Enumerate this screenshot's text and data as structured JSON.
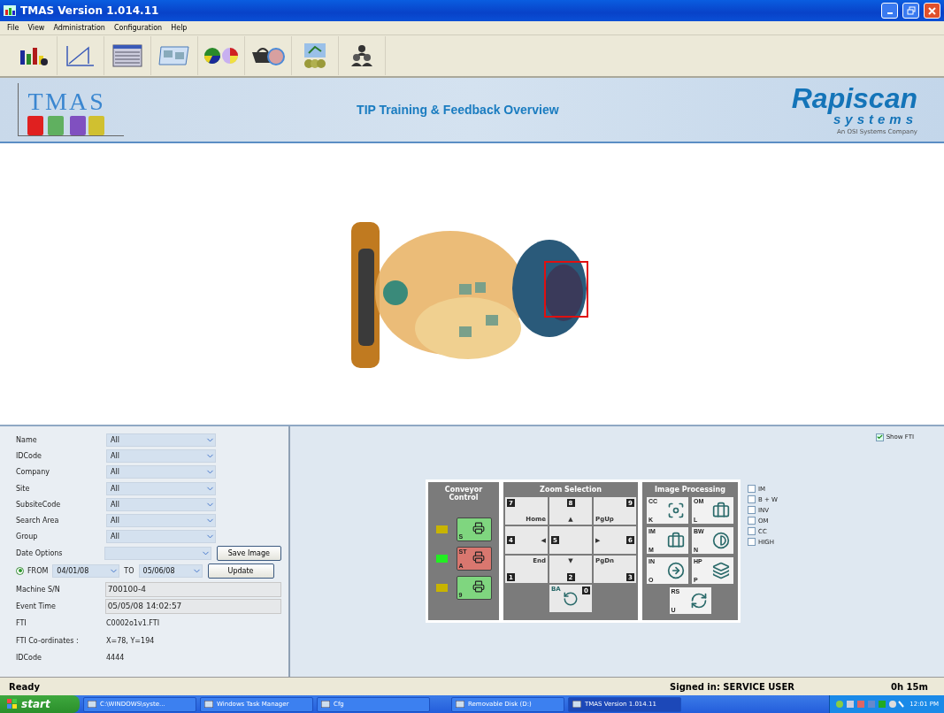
{
  "window": {
    "title": "TMAS Version 1.014.11"
  },
  "menu": [
    "File",
    "View",
    "Administration",
    "Configuration",
    "Help"
  ],
  "header": {
    "logo": "TMAS",
    "title": "TIP Training & Feedback Overview",
    "brand": "Rapiscan",
    "brand_sub": "systems",
    "brand_tagline": "An OSI Systems Company"
  },
  "filters": [
    {
      "label": "Name",
      "value": "All"
    },
    {
      "label": "IDCode",
      "value": "All"
    },
    {
      "label": "Company",
      "value": "All"
    },
    {
      "label": "Site",
      "value": "All"
    },
    {
      "label": "SubsiteCode",
      "value": "All"
    },
    {
      "label": "Search Area",
      "value": "All"
    },
    {
      "label": "Group",
      "value": "All"
    }
  ],
  "date_options": {
    "label": "Date Options"
  },
  "date_range": {
    "selected": true,
    "from_label": "FROM",
    "from": "04/01/08",
    "to_label": "TO",
    "to": "05/06/08"
  },
  "buttons": [
    "Save Image",
    "Update"
  ],
  "details": [
    {
      "label": "Machine S/N",
      "value": "700100-4",
      "kind": "field"
    },
    {
      "label": "Event Time",
      "value": "05/05/08 14:02:57",
      "kind": "field"
    },
    {
      "label": "FTI",
      "value": "C0002o1v1.FTI",
      "kind": "text"
    },
    {
      "label": "FTI Co-ordinates :",
      "value": "X=78, Y=194",
      "kind": "text"
    },
    {
      "label": "IDCode",
      "value": "4444",
      "kind": "text"
    }
  ],
  "show_fti": {
    "label": "Show FTI",
    "checked": true
  },
  "conveyor": {
    "title": "Conveyor Control",
    "lamps": [
      {
        "color": "#c8b400"
      },
      {
        "color": "#22ee22"
      },
      {
        "color": "#c8b400"
      }
    ],
    "buttons": [
      {
        "key": "S",
        "color": "#7fd67f"
      },
      {
        "code": "ST",
        "key": "A",
        "color": "#d9776f"
      },
      {
        "key": "9",
        "color": "#7fd67f"
      }
    ]
  },
  "zoom": {
    "title": "Zoom Selection",
    "keys": [
      {
        "num": "7",
        "label": "Home"
      },
      {
        "num": "8",
        "label": "▲"
      },
      {
        "num": "9",
        "label": "PgUp"
      },
      {
        "num": "4",
        "label": "◀"
      },
      {
        "num": "5"
      },
      {
        "num": "6",
        "label": "▶"
      },
      {
        "num": "1",
        "label": "End"
      },
      {
        "num": "2",
        "label": "▼"
      },
      {
        "num": "3",
        "label": "PgDn"
      }
    ],
    "back": {
      "code": "BA",
      "num": "0"
    }
  },
  "image_processing": {
    "title": "Image Processing",
    "buttons": [
      {
        "code": "CC",
        "key": "K"
      },
      {
        "code": "OM",
        "key": "L"
      },
      {
        "code": "IM",
        "key": "M"
      },
      {
        "code": "BW",
        "key": "N"
      },
      {
        "code": "IN",
        "key": "O"
      },
      {
        "code": "HP",
        "key": "P"
      },
      {
        "code": "RS",
        "key": "U"
      }
    ]
  },
  "options": [
    {
      "label": "IM",
      "checked": false
    },
    {
      "label": "B + W",
      "checked": false
    },
    {
      "label": "INV",
      "checked": false
    },
    {
      "label": "OM",
      "checked": false
    },
    {
      "label": "CC",
      "checked": false
    },
    {
      "label": "HIGH",
      "checked": false
    }
  ],
  "status_bar": {
    "message": "Ready",
    "user": "Signed in: SERVICE USER",
    "elapsed": "0h 15m"
  },
  "taskbar": {
    "start": "start",
    "tasks": [
      {
        "label": "C:\\WINDOWS\\syste...",
        "selected": false
      },
      {
        "label": "Windows Task Manager",
        "selected": false
      },
      {
        "label": "Cfg",
        "selected": false
      },
      {
        "label": "Removable Disk (D:)",
        "selected": false
      },
      {
        "label": "TMAS Version 1.014.11",
        "selected": true
      }
    ],
    "clock": "12:01 PM"
  }
}
